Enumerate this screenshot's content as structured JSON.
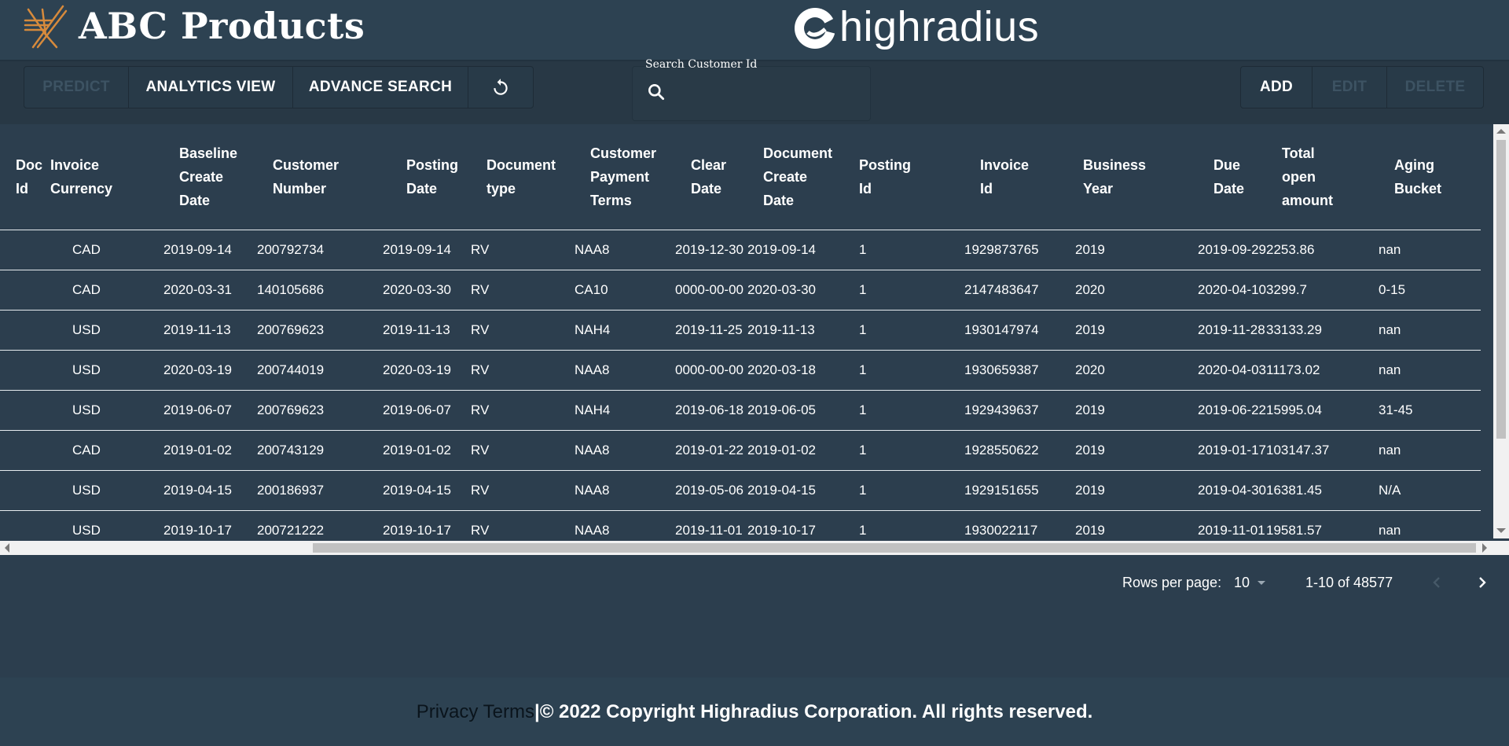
{
  "header": {
    "title": "ABC Products",
    "partner_logo_text": "highradius"
  },
  "toolbar": {
    "predict_label": "PREDICT",
    "analytics_label": "ANALYTICS VIEW",
    "advance_search_label": "ADVANCE SEARCH",
    "add_label": "ADD",
    "edit_label": "EDIT",
    "delete_label": "DELETE"
  },
  "search": {
    "label": "Search Customer Id",
    "value": ""
  },
  "table": {
    "columns": [
      {
        "line1": "Doc",
        "line2": "Id"
      },
      {
        "line1": "Invoice",
        "line2": "Currency"
      },
      {
        "line1": "Baseline",
        "line2": "Create",
        "line3": "Date"
      },
      {
        "line1": "Customer",
        "line2": "Number"
      },
      {
        "line1": "Posting",
        "line2": "Date"
      },
      {
        "line1": "Document",
        "line2": "type"
      },
      {
        "line1": "Customer",
        "line2": "Payment",
        "line3": "Terms"
      },
      {
        "line1": "Clear",
        "line2": "Date"
      },
      {
        "line1": "Document",
        "line2": "Create",
        "line3": "Date"
      },
      {
        "line1": "Posting",
        "line2": "Id"
      },
      {
        "line1": "Invoice",
        "line2": "Id"
      },
      {
        "line1": "Business",
        "line2": "Year"
      },
      {
        "line1": "Due",
        "line2": "Date"
      },
      {
        "line1": "Total",
        "line2": "open",
        "line3": "amount"
      },
      {
        "line1": "Aging",
        "line2": "Bucket"
      }
    ],
    "rows": [
      [
        "",
        "CAD",
        "2019-09-14",
        "200792734",
        "2019-09-14",
        "RV",
        "NAA8",
        "2019-12-30",
        "2019-09-14",
        "1",
        "1929873765",
        "2019",
        "2019-09-29",
        "2253.86",
        "nan"
      ],
      [
        "",
        "CAD",
        "2020-03-31",
        "140105686",
        "2020-03-30",
        "RV",
        "CA10",
        "0000-00-00",
        "2020-03-30",
        "1",
        "2147483647",
        "2020",
        "2020-04-10",
        "3299.7",
        "0-15"
      ],
      [
        "",
        "USD",
        "2019-11-13",
        "200769623",
        "2019-11-13",
        "RV",
        "NAH4",
        "2019-11-25",
        "2019-11-13",
        "1",
        "1930147974",
        "2019",
        "2019-11-28",
        "33133.29",
        "nan"
      ],
      [
        "",
        "USD",
        "2020-03-19",
        "200744019",
        "2020-03-19",
        "RV",
        "NAA8",
        "0000-00-00",
        "2020-03-18",
        "1",
        "1930659387",
        "2020",
        "2020-04-03",
        "11173.02",
        "nan"
      ],
      [
        "",
        "USD",
        "2019-06-07",
        "200769623",
        "2019-06-07",
        "RV",
        "NAH4",
        "2019-06-18",
        "2019-06-05",
        "1",
        "1929439637",
        "2019",
        "2019-06-22",
        "15995.04",
        "31-45"
      ],
      [
        "",
        "CAD",
        "2019-01-02",
        "200743129",
        "2019-01-02",
        "RV",
        "NAA8",
        "2019-01-22",
        "2019-01-02",
        "1",
        "1928550622",
        "2019",
        "2019-01-17",
        "103147.37",
        "nan"
      ],
      [
        "",
        "USD",
        "2019-04-15",
        "200186937",
        "2019-04-15",
        "RV",
        "NAA8",
        "2019-05-06",
        "2019-04-15",
        "1",
        "1929151655",
        "2019",
        "2019-04-30",
        "16381.45",
        "N/A"
      ],
      [
        "",
        "USD",
        "2019-10-17",
        "200721222",
        "2019-10-17",
        "RV",
        "NAA8",
        "2019-11-01",
        "2019-10-17",
        "1",
        "1930022117",
        "2019",
        "2019-11-01",
        "19581.57",
        "nan"
      ]
    ]
  },
  "pagination": {
    "rows_per_page_label": "Rows per page:",
    "rows_per_page_value": "10",
    "range_text": "1-10 of 48577"
  },
  "footer": {
    "privacy_label": "Privacy Terms",
    "separator": "|",
    "copyright": "© 2022 Copyright Highradius Corporation. All rights reserved."
  },
  "colors": {
    "background": "#2c3e4e",
    "header": "#2d4252",
    "logo_accent": "#d68a3c"
  }
}
